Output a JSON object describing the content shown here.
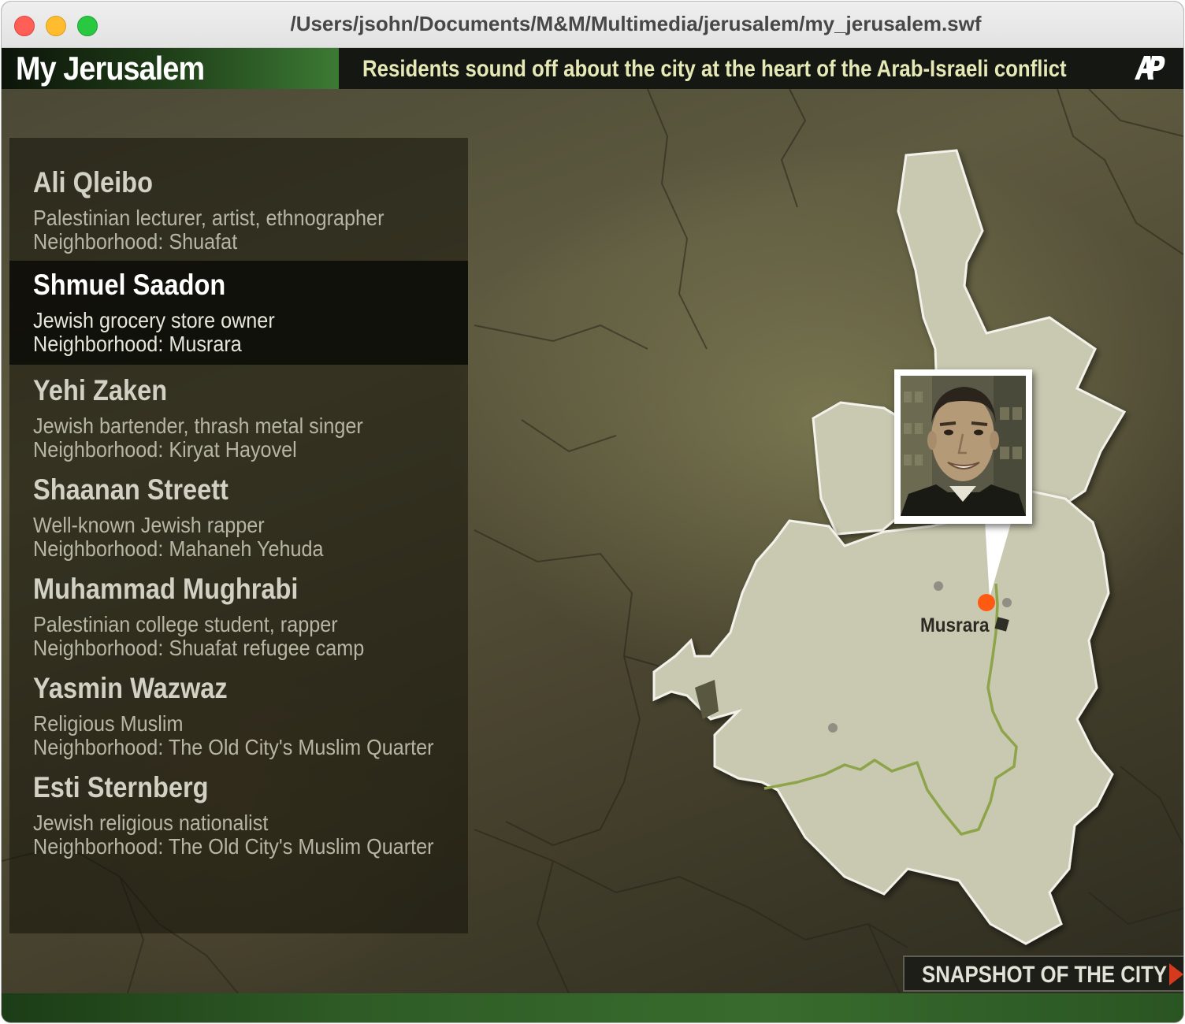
{
  "window": {
    "title": "/Users/jsohn/Documents/M&M/Multimedia/jerusalem/my_jerusalem.swf"
  },
  "header": {
    "brand": "My Jerusalem",
    "tagline": "Residents sound off about the city at the heart of the Arab-Israeli conflict",
    "logo_icon": "ap-logo-icon"
  },
  "people": [
    {
      "name": "Ali Qleibo",
      "role": "Palestinian lecturer, artist, ethnographer",
      "neighborhood": "Neighborhood: Shuafat",
      "selected": false
    },
    {
      "name": "Shmuel Saadon",
      "role": "Jewish grocery store owner",
      "neighborhood": "Neighborhood: Musrara",
      "selected": true
    },
    {
      "name": "Yehi Zaken",
      "role": "Jewish bartender, thrash metal singer",
      "neighborhood": "Neighborhood: Kiryat Hayovel",
      "selected": false
    },
    {
      "name": "Shaanan Streett",
      "role": "Well-known Jewish rapper",
      "neighborhood": "Neighborhood: Mahaneh Yehuda",
      "selected": false
    },
    {
      "name": "Muhammad Mughrabi",
      "role": "Palestinian college student, rapper",
      "neighborhood": "Neighborhood: Shuafat refugee camp",
      "selected": false
    },
    {
      "name": "Yasmin Wazwaz",
      "role": "Religious Muslim",
      "neighborhood": "Neighborhood: The Old City's Muslim Quarter",
      "selected": false
    },
    {
      "name": "Esti Sternberg",
      "role": "Jewish religious nationalist",
      "neighborhood": "Neighborhood: The Old City's Muslim Quarter",
      "selected": false
    }
  ],
  "map": {
    "selected_location": "Musrara",
    "marker_color": "#ff5a12",
    "route_color": "#8da44a",
    "land_color": "#c9c9b1"
  },
  "snapshot_button": {
    "label": "SNAPSHOT OF THE CITY",
    "arrow_icon": "play-arrow-icon",
    "arrow_color": "#d63a1e"
  },
  "colors": {
    "accent_green": "#3c7a34",
    "tagline_color": "#e6e8b6"
  }
}
